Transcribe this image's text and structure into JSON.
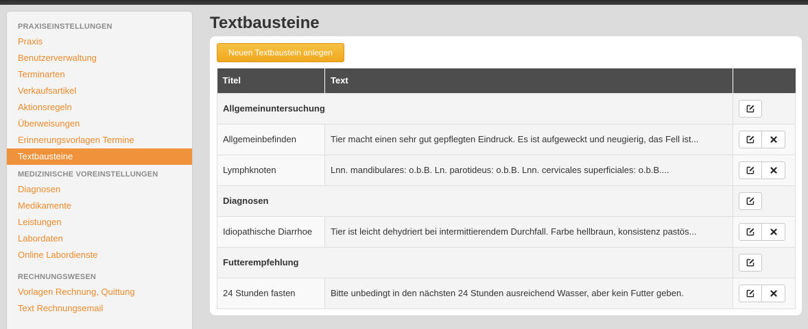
{
  "sidebar": {
    "sections": [
      {
        "title": "PRAXISEINSTELLUNGEN",
        "items": [
          "Praxis",
          "Benutzerverwaltung",
          "Terminarten",
          "Verkaufsartikel",
          "Aktionsregeln",
          "Überweisungen",
          "Erinnerungsvorlagen Termine",
          "Textbausteine"
        ]
      },
      {
        "title": "MEDIZINISCHE VOREINSTELLUNGEN",
        "items": [
          "Diagnosen",
          "Medikamente",
          "Leistungen",
          "Labordaten",
          "Online Labordienste"
        ]
      },
      {
        "title": "RECHNUNGSWESEN",
        "items": [
          "Vorlagen Rechnung, Quittung",
          "Text Rechnungsemail"
        ]
      }
    ],
    "active_item": "Textbausteine"
  },
  "page": {
    "title": "Textbausteine",
    "new_button": "Neuen Textbaustein anlegen"
  },
  "table": {
    "headers": [
      "Titel",
      "Text",
      ""
    ],
    "rows": [
      {
        "type": "group",
        "title": "Allgemeinuntersuchung"
      },
      {
        "type": "item",
        "title": "Allgemeinbefinden",
        "text": "Tier macht einen sehr gut gepflegten Eindruck. Es ist aufgeweckt und neugierig, das Fell ist..."
      },
      {
        "type": "item",
        "title": "Lymphknoten",
        "text": "Lnn. mandibulares: o.b.B. Ln. parotideus: o.b.B. Lnn. cervicales superficiales: o.b.B...."
      },
      {
        "type": "group",
        "title": "Diagnosen"
      },
      {
        "type": "item",
        "title": "Idiopathische Diarrhoe",
        "text": "Tier ist leicht dehydriert bei intermittierendem Durchfall. Farbe hellbraun, konsistenz pastös..."
      },
      {
        "type": "group",
        "title": "Futterempfehlung"
      },
      {
        "type": "item",
        "title": "24 Stunden fasten",
        "text": "Bitte unbedingt in den nächsten 24 Stunden ausreichend Wasser, aber kein Futter geben."
      }
    ],
    "icons": {
      "edit": "edit-icon",
      "delete": "delete-icon"
    }
  },
  "colors": {
    "accent": "#f0923b",
    "link": "#ec8a2c",
    "header_bg": "#4d4d4d",
    "button_yellow": "#f0a81e"
  }
}
